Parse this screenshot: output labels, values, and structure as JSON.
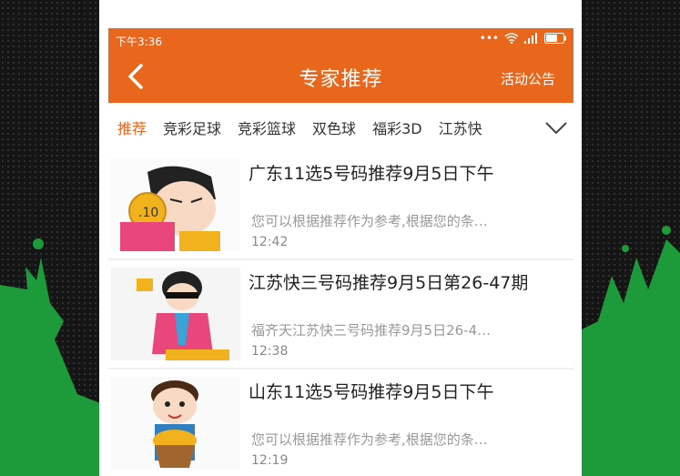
{
  "status_bar": {
    "time": "下午3:36"
  },
  "header": {
    "title": "专家推荐",
    "notice_label": "活动公告"
  },
  "tabs": [
    {
      "label": "推荐",
      "active": true
    },
    {
      "label": "竞彩足球",
      "active": false
    },
    {
      "label": "竞彩篮球",
      "active": false
    },
    {
      "label": "双色球",
      "active": false
    },
    {
      "label": "福彩3D",
      "active": false
    },
    {
      "label": "江苏快",
      "active": false
    }
  ],
  "articles": [
    {
      "title": "广东11选5号码推荐9月5日下午",
      "summary": "您可以根据推荐作为参考,根据您的条…",
      "time": "12:42",
      "thumbnail_icon": "cartoon-coin-holder-icon"
    },
    {
      "title": "江苏快三号码推荐9月5日第26-47期",
      "summary": "福齐天江苏快三号码推荐9月5日26-4…",
      "time": "12:38",
      "thumbnail_icon": "cartoon-sunglasses-man-icon"
    },
    {
      "title": "山东11选5号码推荐9月5日下午",
      "summary": "您可以根据推荐作为参考,根据您的条…",
      "time": "12:19",
      "thumbnail_icon": "cartoon-gold-basket-icon"
    }
  ],
  "colors": {
    "accent": "#e8671d",
    "backdrop_green": "#1d9b3a"
  }
}
